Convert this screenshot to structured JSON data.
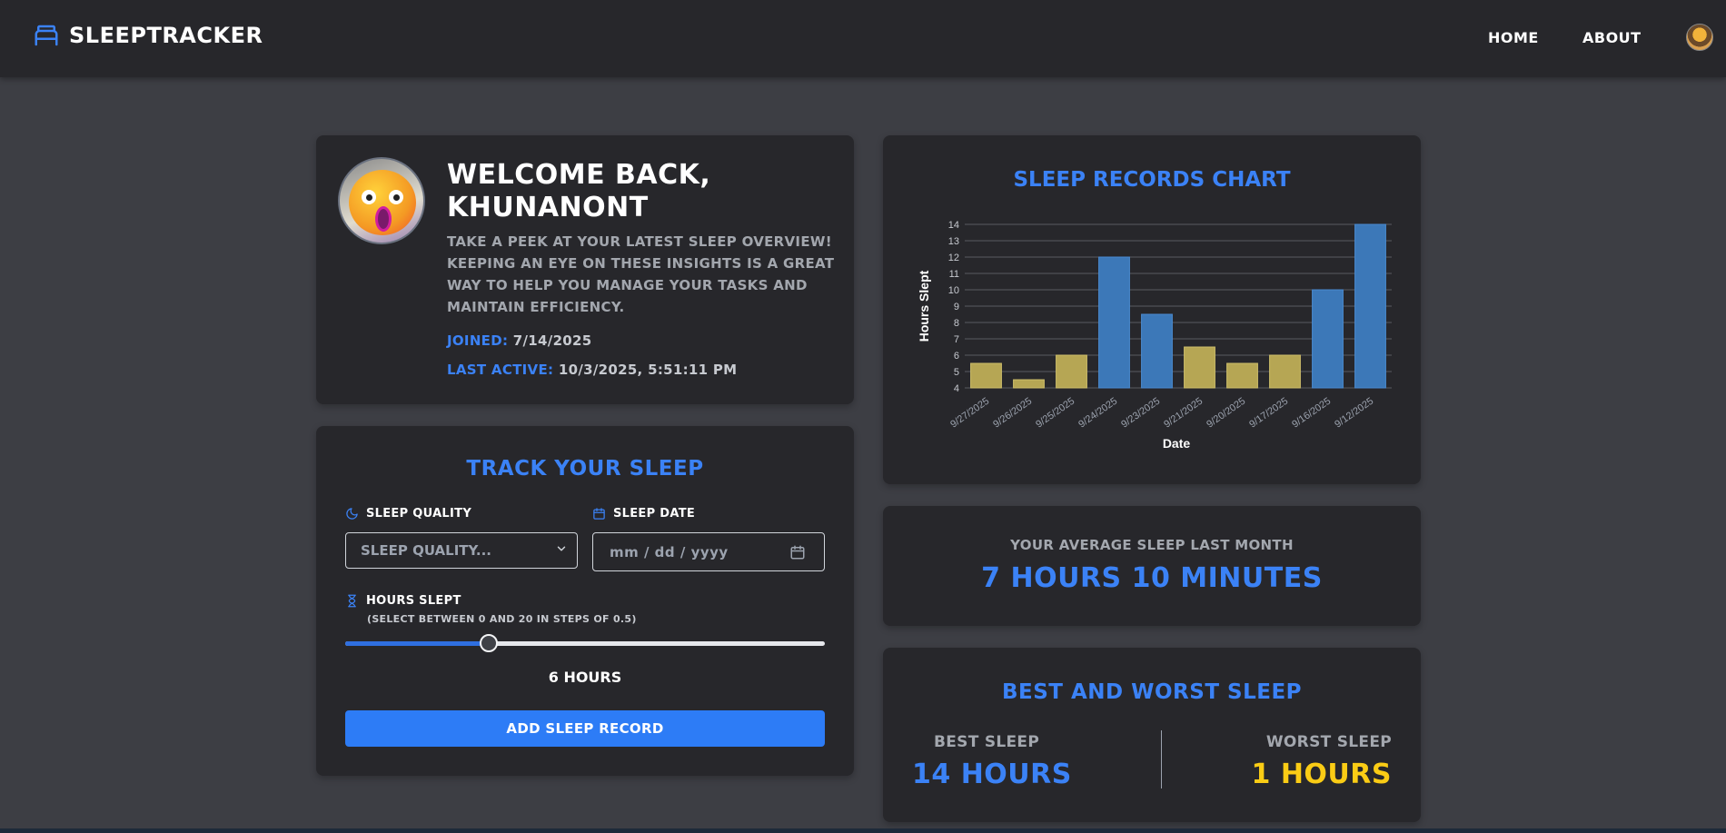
{
  "nav": {
    "brand": "SleepTracker",
    "links": [
      "Home",
      "About"
    ]
  },
  "welcome": {
    "title": "Welcome back, Khunanont",
    "description": "Take a peek at your latest sleep overview! Keeping an eye on these insights is a great way to help you manage your tasks and maintain efficiency.",
    "joined_label": "Joined:",
    "joined_value": "7/14/2025",
    "last_active_label": "Last Active:",
    "last_active_value": "10/3/2025, 5:51:11 PM"
  },
  "track": {
    "title": "Track Your Sleep",
    "quality_label": "Sleep Quality",
    "quality_placeholder": "Sleep Quality...",
    "date_label": "Sleep Date",
    "date_placeholder": "mm / dd / yyyy",
    "hours_label": "Hours Slept",
    "hours_hint": "(Select between 0 and 20 in steps of 0.5)",
    "slider_min": 0,
    "slider_max": 20,
    "slider_value": 6,
    "hours_value_text": "6 hours",
    "add_button": "Add Sleep Record"
  },
  "chart_data": {
    "type": "bar",
    "title": "Sleep Records Chart",
    "xlabel": "Date",
    "ylabel": "Hours Slept",
    "categories": [
      "9/27/2025",
      "9/26/2025",
      "9/25/2025",
      "9/24/2025",
      "9/23/2025",
      "9/21/2025",
      "9/20/2025",
      "9/17/2025",
      "9/16/2025",
      "9/12/2025"
    ],
    "values": [
      5.5,
      4.5,
      6,
      12,
      8.5,
      6.5,
      5.5,
      6,
      10,
      14
    ],
    "bar_colors": [
      "#b6a654",
      "#b6a654",
      "#b6a654",
      "#3c78b8",
      "#3c78b8",
      "#b6a654",
      "#b6a654",
      "#b6a654",
      "#3c78b8",
      "#3c78b8"
    ],
    "ylim": [
      4,
      14
    ],
    "yticks": [
      4,
      5,
      6,
      7,
      8,
      9,
      10,
      11,
      12,
      13,
      14
    ],
    "grid": true
  },
  "average": {
    "label": "Your Average Sleep Last Month",
    "value": "7 Hours 10 Minutes"
  },
  "best_worst": {
    "title": "Best and Worst Sleep",
    "best_label": "Best Sleep",
    "best_value": "14 Hours",
    "worst_label": "Worst Sleep",
    "worst_value": "1 Hours"
  },
  "colors": {
    "accent_blue": "#3b82f6",
    "worst_yellow": "#facc15",
    "button_blue": "#2d7cf6"
  }
}
